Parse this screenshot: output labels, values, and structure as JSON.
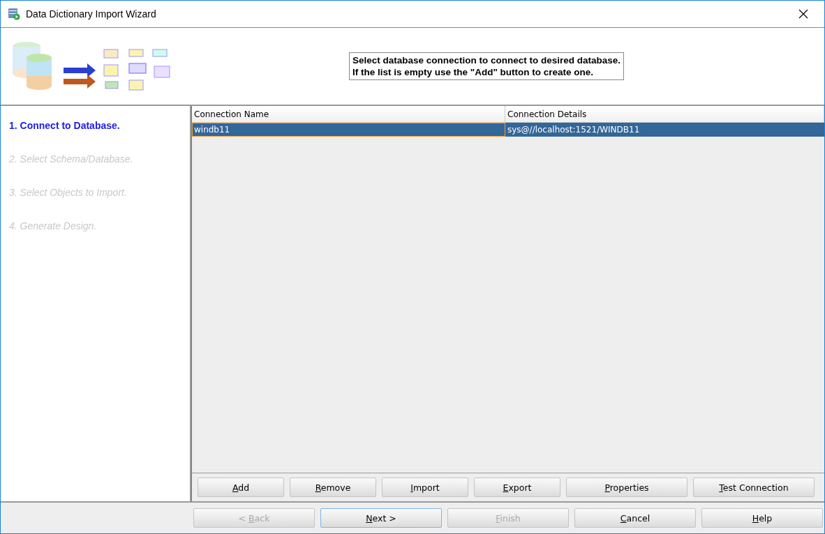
{
  "window": {
    "title": "Data Dictionary Import Wizard"
  },
  "instructions": [
    "Select database connection to connect to desired database.",
    "If the list is empty use the \"Add\" button to create one."
  ],
  "steps": [
    {
      "label": "1. Connect to Database.",
      "selected": true
    },
    {
      "label": "2. Select Schema/Database.",
      "selected": false
    },
    {
      "label": "3. Select Objects to Import.",
      "selected": false
    },
    {
      "label": "4. Generate Design.",
      "selected": false
    }
  ],
  "table": {
    "columns": [
      "Connection Name",
      "Connection Details"
    ],
    "rows": [
      {
        "cells": [
          "windb11",
          "sys@//localhost:1521/WINDB11"
        ],
        "selected": true
      }
    ]
  },
  "table_buttons": [
    {
      "mnemonic": "A",
      "rest": "dd"
    },
    {
      "mnemonic": "R",
      "rest": "emove"
    },
    {
      "mnemonic": "I",
      "rest": "mport"
    },
    {
      "mnemonic": "E",
      "rest": "xport"
    },
    {
      "mnemonic": "P",
      "rest": "roperties"
    },
    {
      "mnemonic": "T",
      "rest": "est Connection"
    }
  ],
  "nav_buttons": [
    {
      "prefix": "< ",
      "mnemonic": "B",
      "rest": "ack",
      "disabled": true,
      "focused": false
    },
    {
      "mnemonic": "N",
      "rest": "ext >",
      "disabled": false,
      "focused": true
    },
    {
      "mnemonic": "F",
      "rest": "inish",
      "disabled": true,
      "focused": false
    },
    {
      "mnemonic": "C",
      "rest": "ancel",
      "disabled": false,
      "focused": false
    },
    {
      "mnemonic": "H",
      "rest": "elp",
      "disabled": false,
      "focused": false
    }
  ]
}
